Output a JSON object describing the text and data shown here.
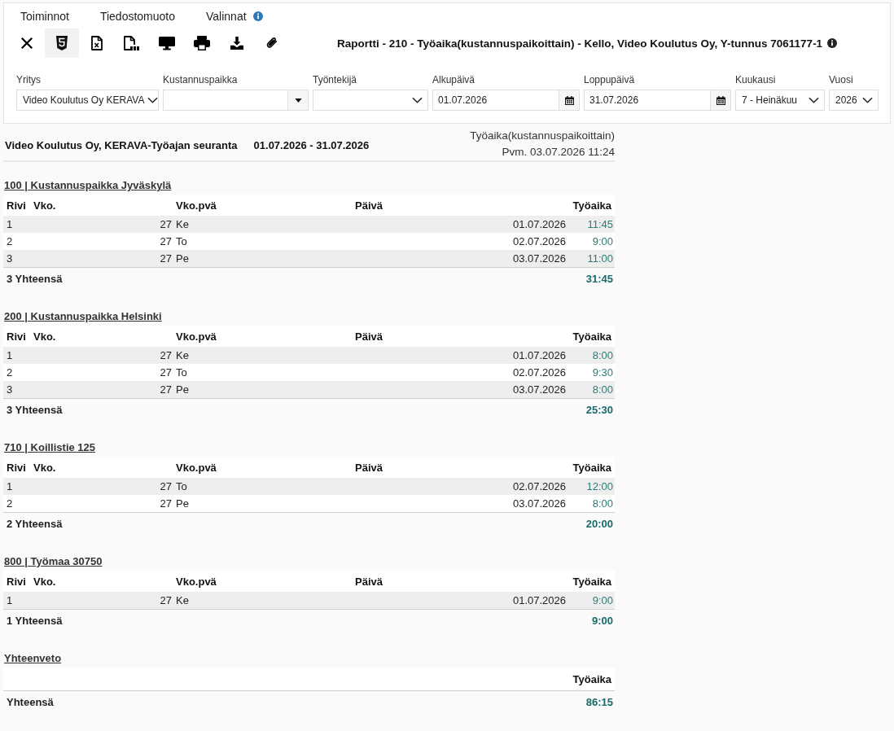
{
  "menu": [
    {
      "label": "Toiminnot",
      "info": false
    },
    {
      "label": "Tiedostomuoto",
      "info": false
    },
    {
      "label": "Valinnat",
      "info": true
    }
  ],
  "toolbar": {
    "buttons": [
      {
        "kind": "close",
        "selected": false
      },
      {
        "kind": "html",
        "selected": true
      },
      {
        "kind": "excel",
        "selected": false
      },
      {
        "kind": "pdf",
        "selected": false
      },
      {
        "kind": "screen",
        "selected": false
      },
      {
        "kind": "print",
        "selected": false
      },
      {
        "kind": "download",
        "selected": false
      },
      {
        "kind": "attach",
        "selected": false
      }
    ],
    "title": "Raportti - 210 - Työaika(kustannuspaikoittain) - Kello, Video Koulutus Oy, Y-tunnus 7061177-1",
    "title_info": true
  },
  "filters": [
    {
      "label": "Yritys",
      "kind": "select",
      "value": "Video Koulutus Oy KERAVA"
    },
    {
      "label": "Kustannuspaikka",
      "kind": "combo"
    },
    {
      "label": "Työntekijä",
      "kind": "select"
    },
    {
      "label": "Alkupäivä",
      "kind": "date",
      "value": "01.07.2026"
    },
    {
      "label": "Loppupäivä",
      "kind": "date",
      "value": "31.07.2026"
    },
    {
      "label": "Kuukausi",
      "kind": "select",
      "value": "7 - Heinäkuu"
    },
    {
      "label": "Vuosi",
      "kind": "select",
      "value": "2026"
    }
  ],
  "report": {
    "title": "Video Koulutus Oy, KERAVA-Työajan seuranta",
    "period": "01.07.2026 - 31.07.2026",
    "type": "Työaika(kustannuspaikoittain)",
    "timestamp": "Pvm. 03.07.2026 11:24"
  },
  "sections": [
    {
      "heading": "100 | Kustannuspaikka Jyväskylä",
      "columns": [
        "Rivi",
        "Vko.",
        "Vko.pvä",
        "Päivä",
        "Työaika"
      ],
      "rows": [
        {
          "row": "1",
          "week": "27",
          "weekday": "Ke",
          "date": "01.07.2026",
          "hours": "11:45"
        },
        {
          "row": "2",
          "week": "27",
          "weekday": "To",
          "date": "02.07.2026",
          "hours": "9:00"
        },
        {
          "row": "3",
          "week": "27",
          "weekday": "Pe",
          "date": "03.07.2026",
          "hours": "11:00"
        }
      ],
      "total_label": "3 Yhteensä",
      "total": "31:45"
    },
    {
      "heading": "200 | Kustannuspaikka Helsinki",
      "columns": [
        "Rivi",
        "Vko.",
        "Vko.pvä",
        "Päivä",
        "Työaika"
      ],
      "rows": [
        {
          "row": "1",
          "week": "27",
          "weekday": "Ke",
          "date": "01.07.2026",
          "hours": "8:00"
        },
        {
          "row": "2",
          "week": "27",
          "weekday": "To",
          "date": "02.07.2026",
          "hours": "9:30"
        },
        {
          "row": "3",
          "week": "27",
          "weekday": "Pe",
          "date": "03.07.2026",
          "hours": "8:00"
        }
      ],
      "total_label": "3 Yhteensä",
      "total": "25:30"
    },
    {
      "heading": "710 | Koillistie 125",
      "columns": [
        "Rivi",
        "Vko.",
        "Vko.pvä",
        "Päivä",
        "Työaika"
      ],
      "rows": [
        {
          "row": "1",
          "week": "27",
          "weekday": "To",
          "date": "02.07.2026",
          "hours": "12:00"
        },
        {
          "row": "2",
          "week": "27",
          "weekday": "Pe",
          "date": "03.07.2026",
          "hours": "8:00"
        }
      ],
      "total_label": "2 Yhteensä",
      "total": "20:00"
    },
    {
      "heading": "800 | Työmaa 30750",
      "columns": [
        "Rivi",
        "Vko.",
        "Vko.pvä",
        "Päivä",
        "Työaika"
      ],
      "rows": [
        {
          "row": "1",
          "week": "27",
          "weekday": "Ke",
          "date": "01.07.2026",
          "hours": "9:00"
        }
      ],
      "total_label": "1 Yhteensä",
      "total": "9:00"
    }
  ],
  "summary": {
    "heading": "Yhteenveto",
    "column": "Työaika",
    "total_label": "Yhteensä",
    "total": "86:15"
  }
}
